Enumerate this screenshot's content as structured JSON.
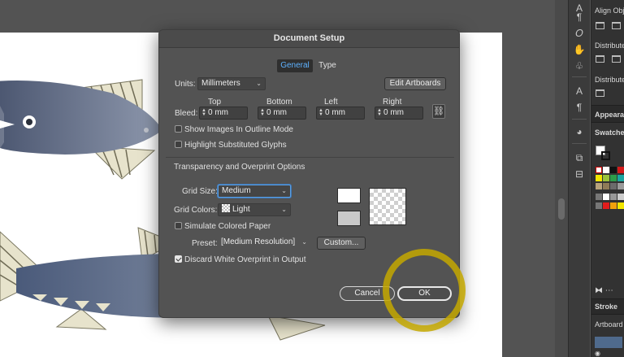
{
  "dialog": {
    "title": "Document Setup",
    "tabs": [
      {
        "label": "General",
        "selected": true
      },
      {
        "label": "Type",
        "selected": false
      }
    ],
    "units_label": "Units:",
    "units_value": "Millimeters",
    "edit_artboards_label": "Edit Artboards",
    "bleed_label": "Bleed:",
    "bleed": [
      {
        "label": "Top",
        "value": "0 mm"
      },
      {
        "label": "Bottom",
        "value": "0 mm"
      },
      {
        "label": "Left",
        "value": "0 mm"
      },
      {
        "label": "Right",
        "value": "0 mm"
      }
    ],
    "show_images_outline": {
      "label": "Show Images In Outline Mode",
      "checked": false
    },
    "highlight_glyphs": {
      "label": "Highlight Substituted Glyphs",
      "checked": false
    },
    "transparency_section": "Transparency and Overprint Options",
    "grid_size_label": "Grid Size:",
    "grid_size_value": "Medium",
    "grid_colors_label": "Grid Colors:",
    "grid_colors_value": "Light",
    "simulate_paper": {
      "label": "Simulate Colored Paper",
      "checked": false
    },
    "preset_label": "Preset:",
    "preset_value": "[Medium Resolution]",
    "custom_label": "Custom...",
    "discard_overprint": {
      "label": "Discard White Overprint in Output",
      "checked": true
    },
    "cancel_label": "Cancel",
    "ok_label": "OK"
  },
  "right_panel": {
    "align_objects": "Align Obje",
    "distribute_1": "Distribute",
    "distribute_2": "Distribute",
    "appearance": "Appearan",
    "swatches": "Swatches",
    "stroke": "Stroke",
    "artboards": "Artboard"
  },
  "colors": {
    "tab_active_text": "#5eb2ff",
    "focus_ring": "#5b9fe3",
    "cursor_highlight": "#c4a800"
  }
}
